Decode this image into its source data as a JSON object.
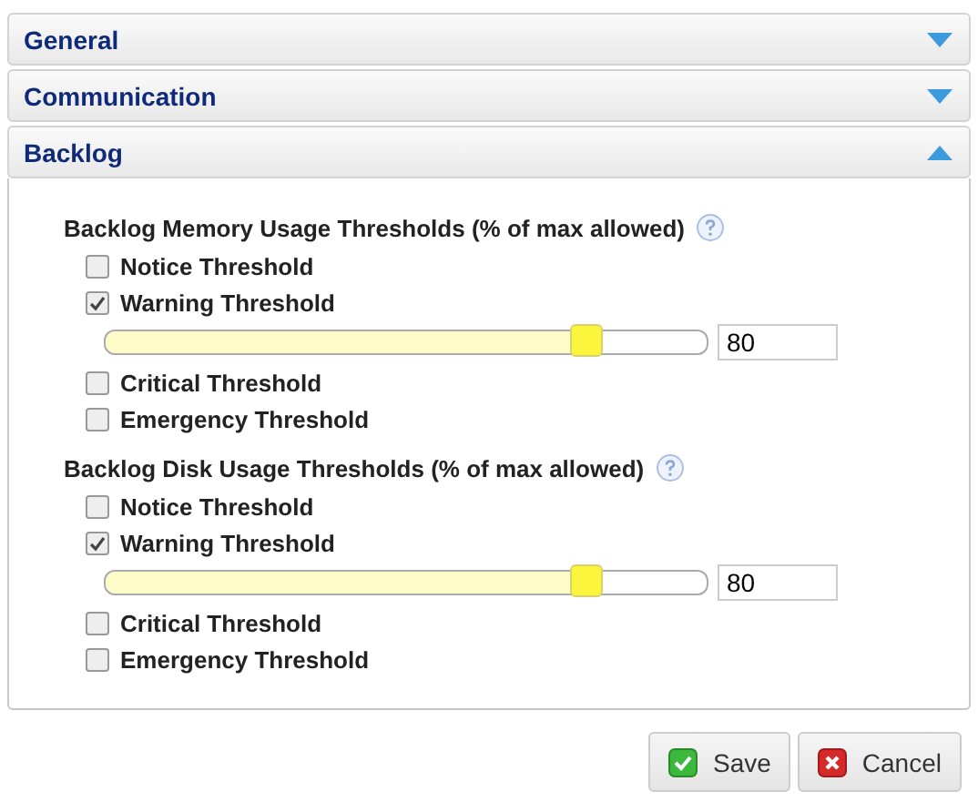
{
  "sections": [
    {
      "title": "General",
      "expanded": false
    },
    {
      "title": "Communication",
      "expanded": false
    },
    {
      "title": "Backlog",
      "expanded": true,
      "groups": [
        {
          "title": "Backlog Memory Usage Thresholds (% of max allowed)",
          "items": [
            {
              "kind": "checkbox",
              "label": "Notice Threshold",
              "checked": false
            },
            {
              "kind": "checkbox",
              "label": "Warning Threshold",
              "checked": true
            },
            {
              "kind": "slider",
              "level": 0.8,
              "value": "80"
            },
            {
              "kind": "checkbox",
              "label": "Critical Threshold",
              "checked": false
            },
            {
              "kind": "checkbox",
              "label": "Emergency Threshold",
              "checked": false
            }
          ]
        },
        {
          "title": "Backlog Disk Usage Thresholds (% of max allowed)",
          "items": [
            {
              "kind": "checkbox",
              "label": "Notice Threshold",
              "checked": false
            },
            {
              "kind": "checkbox",
              "label": "Warning Threshold",
              "checked": true
            },
            {
              "kind": "slider",
              "level": 0.8,
              "value": "80"
            },
            {
              "kind": "checkbox",
              "label": "Critical Threshold",
              "checked": false
            },
            {
              "kind": "checkbox",
              "label": "Emergency Threshold",
              "checked": false
            }
          ]
        }
      ]
    }
  ],
  "buttons": [
    {
      "kind": "save",
      "label": "Save"
    },
    {
      "kind": "cancel",
      "label": "Cancel"
    }
  ]
}
